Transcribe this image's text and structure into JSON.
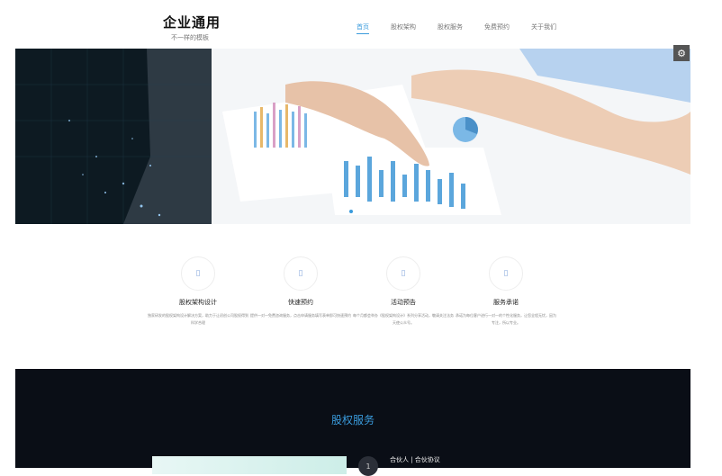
{
  "brand": {
    "name": "企业通用",
    "tagline": "不一样的模板"
  },
  "nav": [
    {
      "label": "首页",
      "active": true
    },
    {
      "label": "股权架构",
      "active": false
    },
    {
      "label": "股权服务",
      "active": false
    },
    {
      "label": "免费预约",
      "active": false
    },
    {
      "label": "关于我们",
      "active": false
    }
  ],
  "features": [
    {
      "title": "股权架构设计",
      "desc": "独家研发的股权架构设计解决方案，助力于让初创公司股权得到科学合理"
    },
    {
      "title": "快速预约",
      "desc": "提供一对一免费咨询服务，点击申请服务填写表单即可快速预约"
    },
    {
      "title": "活动预告",
      "desc": "每个月都会举办《股权架构设计》系列分享活动，敬请关注法务天使公众号。"
    },
    {
      "title": "服务承诺",
      "desc": "承诺为每位客户进行一对一的个性化服务，让您全程无忧，因为专注，所以专业。"
    }
  ],
  "section": {
    "title": "股权服务",
    "item_label": "合伙人 | 合伙协议",
    "item_number": "1"
  },
  "colors": {
    "accent": "#3a9bdc",
    "dark": "#0a0e16"
  },
  "icons": {
    "settings": "gear-icon"
  }
}
